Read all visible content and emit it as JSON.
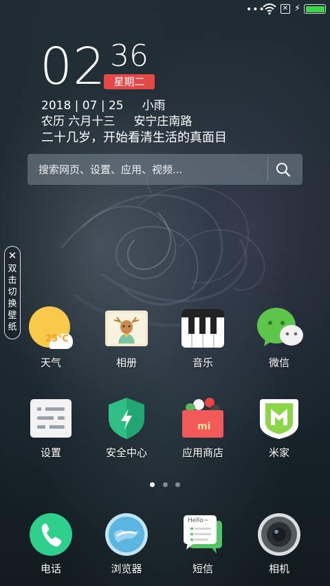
{
  "status_bar": {
    "more_dots": "•••",
    "sim_icon": "sim-x-icon",
    "battery_level_percent": 100,
    "battery_color": "#3fd34a"
  },
  "clock": {
    "hour": "02",
    "minute": "36",
    "weekday": "星期二",
    "weekday_badge_color": "#e64848"
  },
  "info": {
    "date": "2018 | 07 | 25",
    "weather": "小雨",
    "lunar": "农历 六月十三",
    "location": "安宁庄南路",
    "motto": "二十几岁，开始看清生活的真面目"
  },
  "search": {
    "placeholder": "搜索网页、设置、应用、视频..."
  },
  "side_tab": {
    "close": "✕",
    "label": "双击切换壁纸"
  },
  "apps_row1": [
    {
      "label": "天气",
      "icon": "weather-icon"
    },
    {
      "label": "相册",
      "icon": "gallery-icon"
    },
    {
      "label": "音乐",
      "icon": "music-icon"
    },
    {
      "label": "微信",
      "icon": "wechat-icon"
    }
  ],
  "weather_temp": "25℃",
  "apps_row2": [
    {
      "label": "设置",
      "icon": "settings-icon"
    },
    {
      "label": "安全中心",
      "icon": "security-icon"
    },
    {
      "label": "应用商店",
      "icon": "app-store-icon"
    },
    {
      "label": "米家",
      "icon": "mijia-icon"
    }
  ],
  "store_logo_text": "mi",
  "page_indicator": {
    "count": 3,
    "active": 0
  },
  "dock": [
    {
      "label": "电话",
      "icon": "phone-icon"
    },
    {
      "label": "浏览器",
      "icon": "browser-icon"
    },
    {
      "label": "短信",
      "icon": "messages-icon"
    },
    {
      "label": "相机",
      "icon": "camera-icon"
    }
  ],
  "sms_bubble_text": "Hello~"
}
